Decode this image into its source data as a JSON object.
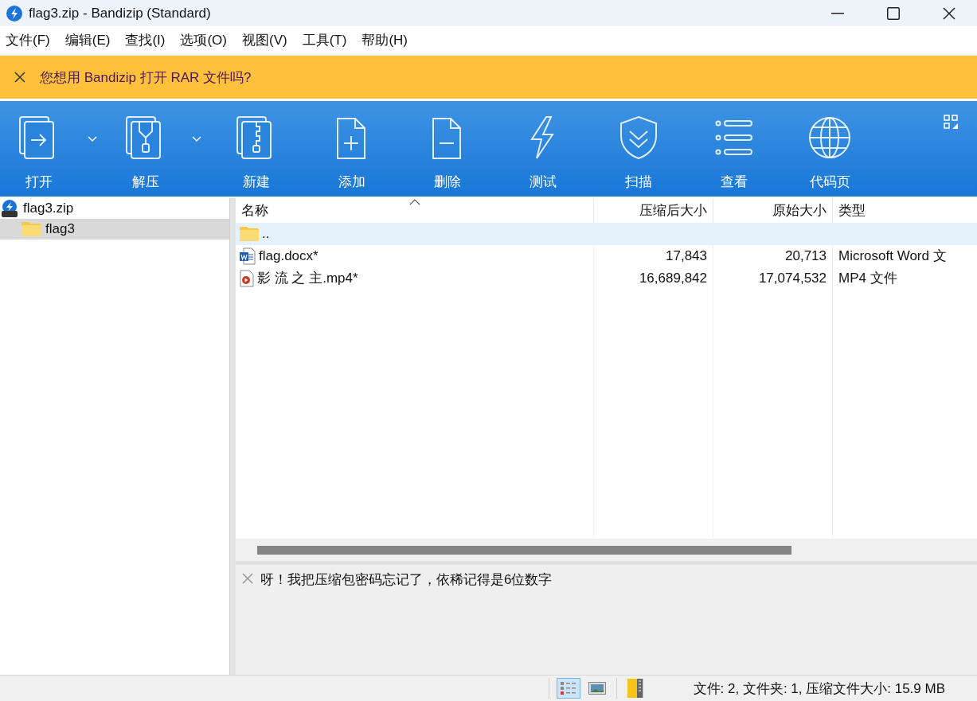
{
  "window": {
    "title": "flag3.zip - Bandizip (Standard)"
  },
  "menu": [
    "文件(F)",
    "编辑(E)",
    "查找(I)",
    "选项(O)",
    "视图(V)",
    "工具(T)",
    "帮助(H)"
  ],
  "notice": {
    "text": "您想用 Bandizip 打开 RAR 文件吗?"
  },
  "toolbar": [
    {
      "kind": "open",
      "label": "打开",
      "dropdown": true
    },
    {
      "kind": "extract",
      "label": "解压",
      "dropdown": true
    },
    {
      "kind": "new",
      "label": "新建",
      "dropdown": false
    },
    {
      "kind": "add",
      "label": "添加",
      "dropdown": false
    },
    {
      "kind": "delete",
      "label": "删除",
      "dropdown": false
    },
    {
      "kind": "test",
      "label": "测试",
      "dropdown": false
    },
    {
      "kind": "scan",
      "label": "扫描",
      "dropdown": false
    },
    {
      "kind": "view",
      "label": "查看",
      "dropdown": false
    },
    {
      "kind": "codepage",
      "label": "代码页",
      "dropdown": false
    }
  ],
  "tree": [
    {
      "kind": "archive",
      "label": "flag3.zip",
      "selected": false,
      "children": [
        {
          "kind": "folder",
          "label": "flag3",
          "selected": true
        }
      ]
    }
  ],
  "table": {
    "columns": [
      {
        "label": "名称",
        "sorted": true
      },
      {
        "label": "压缩后大小",
        "sorted": false
      },
      {
        "label": "原始大小",
        "sorted": false
      },
      {
        "label": "类型",
        "sorted": false
      }
    ],
    "rows": [
      {
        "kind": "folder",
        "name": "..",
        "selected": true
      },
      {
        "kind": "document",
        "name": "flag.docx*",
        "packed": "17,843",
        "original": "20,713",
        "type": "Microsoft Word 文",
        "selected": false
      },
      {
        "kind": "video",
        "name": "影 流 之 主.mp4*",
        "packed": "16,689,842",
        "original": "17,074,532",
        "type": "MP4 文件",
        "selected": false
      }
    ]
  },
  "comment": {
    "text": "呀！我把压缩包密码忘记了，依稀记得是6位数字"
  },
  "status_bar": {
    "view_buttons": [
      {
        "kind": "details",
        "selected": true
      },
      {
        "kind": "thumbnails",
        "selected": false
      }
    ],
    "text": "文件: 2, 文件夹: 1, 压缩文件大小: 15.9 MB"
  }
}
